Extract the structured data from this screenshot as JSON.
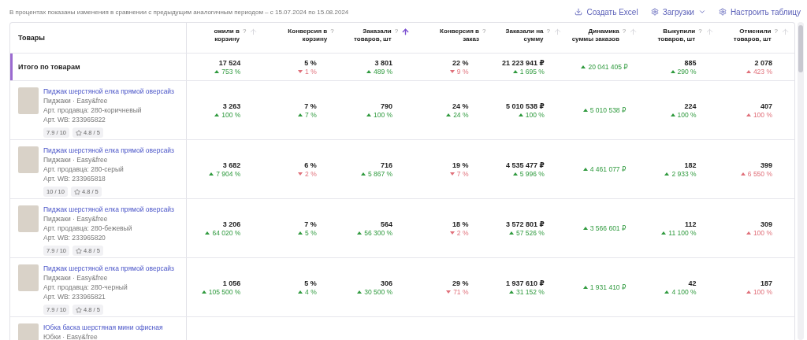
{
  "note": "В процентах показаны изменения в сравнении с предыдущим аналогичным периодом – с 15.07.2024 по 15.08.2024",
  "actions": [
    {
      "label": "Создать Excel",
      "dropdown": false
    },
    {
      "label": "Загрузки",
      "dropdown": true
    },
    {
      "label": "Настроить таблицу",
      "dropdown": false
    }
  ],
  "table": {
    "product_heading": "Товары",
    "columns": [
      {
        "label": "ожили в корзину",
        "help": "?",
        "sorted": false
      },
      {
        "label": "Конверсия в корзину",
        "help": "?"
      },
      {
        "label": "Заказали товаров, шт",
        "help": "?",
        "sorted": true
      },
      {
        "label": "Конверсия в заказ",
        "help": "?"
      },
      {
        "label": "Заказали на сумму",
        "help": "?",
        "sorted": false
      },
      {
        "label": "Динамика суммы заказов",
        "help": "?",
        "sorted": false
      },
      {
        "label": "Выкупили товаров, шт",
        "help": "?",
        "sorted": false
      },
      {
        "label": "Отменили товаров, шт",
        "help": "?",
        "sorted": false
      }
    ],
    "total": {
      "label": "Итого по товарам",
      "cells": [
        {
          "value": "17 524",
          "change": "753 %",
          "rising": true,
          "positive": true
        },
        {
          "value": "5 %",
          "change": "1 %",
          "rising": false,
          "positive": false
        },
        {
          "value": "3 801",
          "change": "489 %",
          "rising": true,
          "positive": true
        },
        {
          "value": "22 %",
          "change": "9 %",
          "rising": false,
          "positive": false
        },
        {
          "value": "21 223 941 ₽",
          "change": "1 695 %",
          "rising": true,
          "positive": true
        },
        {
          "change": "20 041 405 ₽",
          "rising": true,
          "positive": true
        },
        {
          "value": "885",
          "change": "290 %",
          "rising": true,
          "positive": true
        },
        {
          "value": "2 078",
          "change": "423 %",
          "rising": true,
          "positive": false
        }
      ]
    },
    "rows": [
      {
        "title": "Пиджак шерстяной елка прямой оверсайз",
        "category": "Пиджаки · Easy&free",
        "seller_article": "Арт. продавца: 280-коричневый",
        "wb_article": "Арт. WB: 233965822",
        "score": "7.9 / 10",
        "rating": "4.8 / 5",
        "cells": [
          {
            "value": "3 263",
            "change": "100 %",
            "rising": true,
            "positive": true
          },
          {
            "value": "7 %",
            "change": "7 %",
            "rising": true,
            "positive": true
          },
          {
            "value": "790",
            "change": "100 %",
            "rising": true,
            "positive": true
          },
          {
            "value": "24 %",
            "change": "24 %",
            "rising": true,
            "positive": true
          },
          {
            "value": "5 010 538 ₽",
            "change": "100 %",
            "rising": true,
            "positive": true
          },
          {
            "change": "5 010 538 ₽",
            "rising": true,
            "positive": true
          },
          {
            "value": "224",
            "change": "100 %",
            "rising": true,
            "positive": true
          },
          {
            "value": "407",
            "change": "100 %",
            "rising": true,
            "positive": false
          }
        ]
      },
      {
        "title": "Пиджак шерстяной елка прямой оверсайз",
        "category": "Пиджаки · Easy&free",
        "seller_article": "Арт. продавца: 280-серый",
        "wb_article": "Арт. WB: 233965818",
        "score": "10 / 10",
        "rating": "4.8 / 5",
        "cells": [
          {
            "value": "3 682",
            "change": "7 904 %",
            "rising": true,
            "positive": true
          },
          {
            "value": "6 %",
            "change": "2 %",
            "rising": false,
            "positive": false
          },
          {
            "value": "716",
            "change": "5 867 %",
            "rising": true,
            "positive": true
          },
          {
            "value": "19 %",
            "change": "7 %",
            "rising": false,
            "positive": false
          },
          {
            "value": "4 535 477 ₽",
            "change": "5 996 %",
            "rising": true,
            "positive": true
          },
          {
            "change": "4 461 077 ₽",
            "rising": true,
            "positive": true
          },
          {
            "value": "182",
            "change": "2 933 %",
            "rising": true,
            "positive": true
          },
          {
            "value": "399",
            "change": "6 550 %",
            "rising": true,
            "positive": false
          }
        ]
      },
      {
        "title": "Пиджак шерстяной елка прямой оверсайз",
        "category": "Пиджаки · Easy&free",
        "seller_article": "Арт. продавца: 280-бежевый",
        "wb_article": "Арт. WB: 233965820",
        "score": "7.9 / 10",
        "rating": "4.8 / 5",
        "cells": [
          {
            "value": "3 206",
            "change": "64 020 %",
            "rising": true,
            "positive": true
          },
          {
            "value": "7 %",
            "change": "5 %",
            "rising": true,
            "positive": true
          },
          {
            "value": "564",
            "change": "56 300 %",
            "rising": true,
            "positive": true
          },
          {
            "value": "18 %",
            "change": "2 %",
            "rising": false,
            "positive": false
          },
          {
            "value": "3 572 801 ₽",
            "change": "57 526 %",
            "rising": true,
            "positive": true
          },
          {
            "change": "3 566 601 ₽",
            "rising": true,
            "positive": true
          },
          {
            "value": "112",
            "change": "11 100 %",
            "rising": true,
            "positive": true
          },
          {
            "value": "309",
            "change": "100 %",
            "rising": true,
            "positive": false
          }
        ]
      },
      {
        "title": "Пиджак шерстяной елка прямой оверсайз",
        "category": "Пиджаки · Easy&free",
        "seller_article": "Арт. продавца: 280-черный",
        "wb_article": "Арт. WB: 233965821",
        "score": "7.9 / 10",
        "rating": "4.8 / 5",
        "cells": [
          {
            "value": "1 056",
            "change": "105 500 %",
            "rising": true,
            "positive": true
          },
          {
            "value": "5 %",
            "change": "4 %",
            "rising": true,
            "positive": true
          },
          {
            "value": "306",
            "change": "30 500 %",
            "rising": true,
            "positive": true
          },
          {
            "value": "29 %",
            "change": "71 %",
            "rising": false,
            "positive": false
          },
          {
            "value": "1 937 610 ₽",
            "change": "31 152 %",
            "rising": true,
            "positive": true
          },
          {
            "change": "1 931 410 ₽",
            "rising": true,
            "positive": true
          },
          {
            "value": "42",
            "change": "4 100 %",
            "rising": true,
            "positive": true
          },
          {
            "value": "187",
            "change": "100 %",
            "rising": true,
            "positive": false
          }
        ]
      },
      {
        "title": "Юбка баска шерстяная мини офисная",
        "category": "Юбки · Easy&free"
      }
    ]
  }
}
